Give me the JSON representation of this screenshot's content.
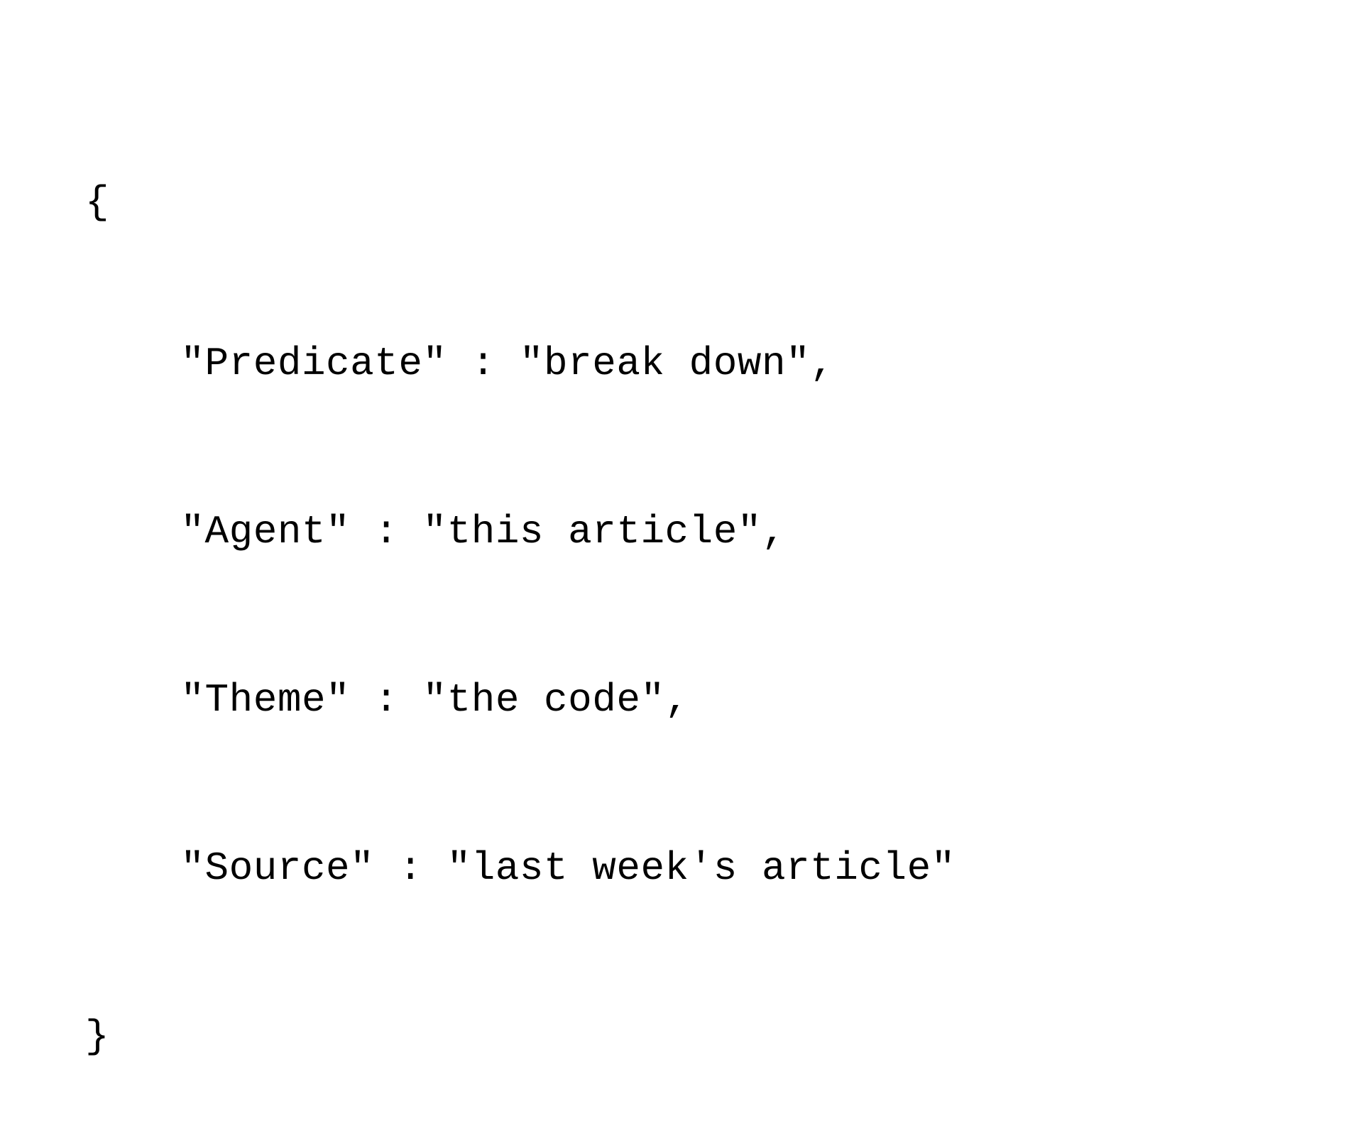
{
  "code": {
    "open_brace": "{",
    "close_brace": "}",
    "entries": [
      {
        "key": "\"Predicate\"",
        "sep": " : ",
        "value": "\"break down\"",
        "trailing": ","
      },
      {
        "key": "\"Agent\"",
        "sep": " : ",
        "value": "\"this article\"",
        "trailing": ","
      },
      {
        "key": "\"Theme\"",
        "sep": " : ",
        "value": "\"the code\"",
        "trailing": ","
      },
      {
        "key": "\"Source\"",
        "sep": " : ",
        "value": "\"last week's article\"",
        "trailing": ""
      }
    ]
  }
}
